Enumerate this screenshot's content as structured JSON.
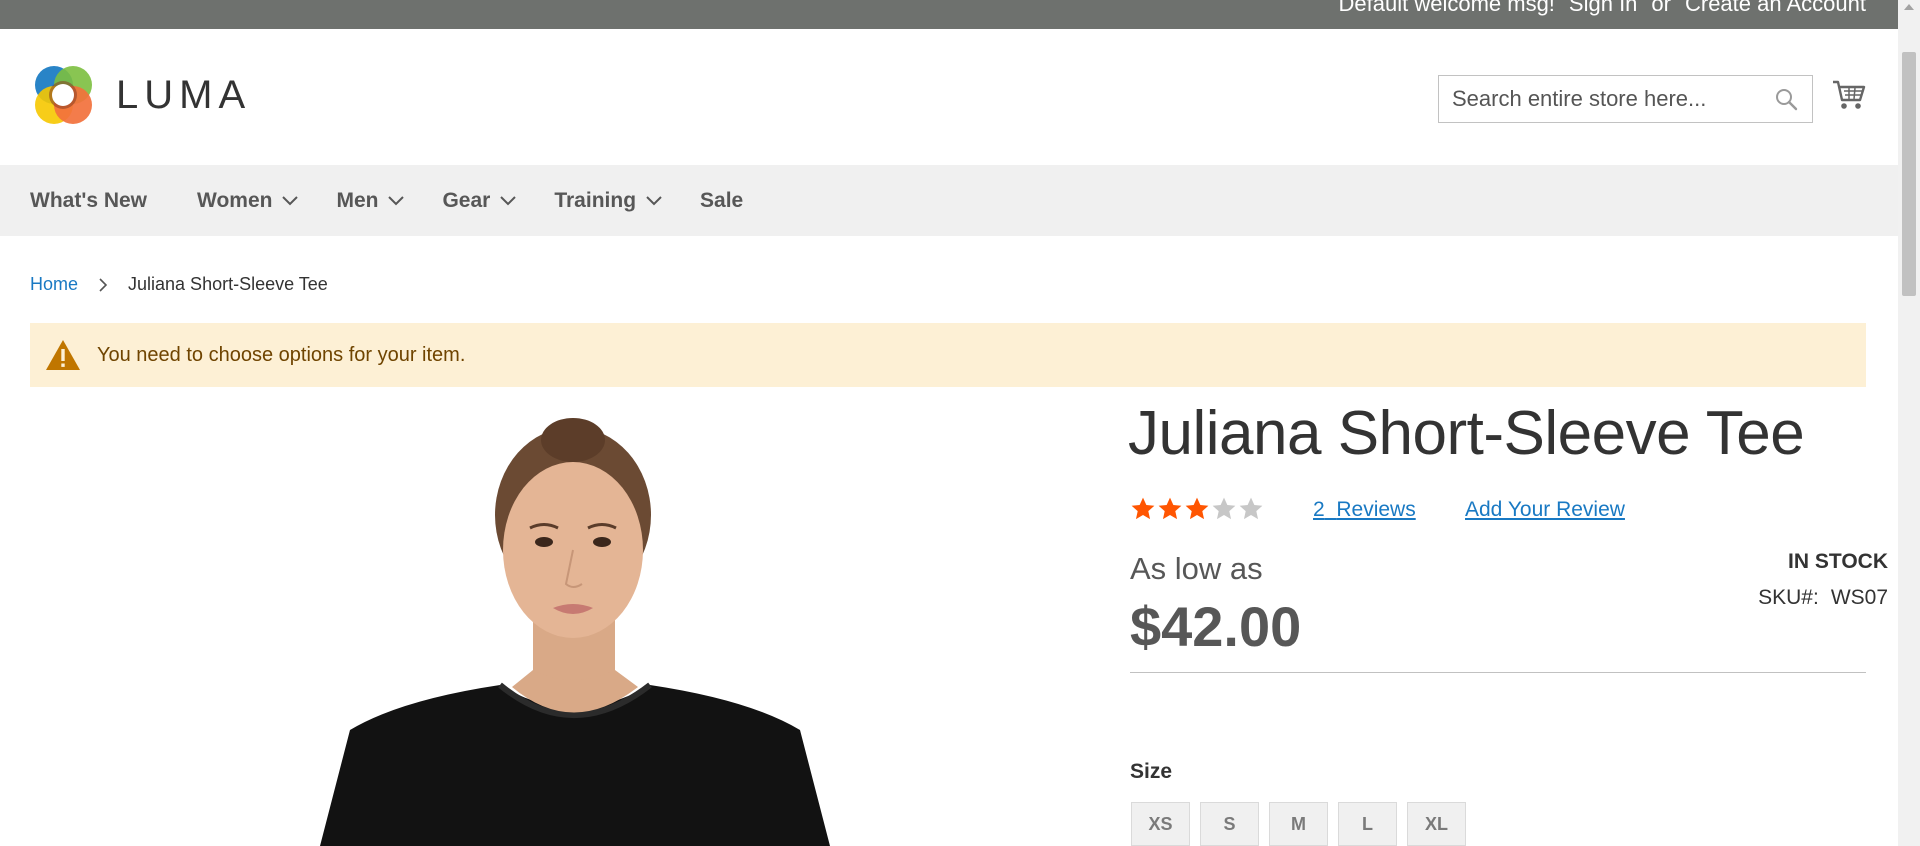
{
  "top_bar": {
    "welcome": "Default welcome msg!",
    "sign_in": "Sign In",
    "or": "or",
    "create_account": "Create an Account"
  },
  "header": {
    "logo_text": "LUMA",
    "search_placeholder": "Search entire store here...",
    "search_icon": "search-icon",
    "cart_icon": "cart-icon"
  },
  "nav": {
    "items": [
      {
        "label": "What's New",
        "has_dropdown": false
      },
      {
        "label": "Women",
        "has_dropdown": true
      },
      {
        "label": "Men",
        "has_dropdown": true
      },
      {
        "label": "Gear",
        "has_dropdown": true
      },
      {
        "label": "Training",
        "has_dropdown": true
      },
      {
        "label": "Sale",
        "has_dropdown": false
      }
    ]
  },
  "breadcrumb": {
    "home": "Home",
    "current": "Juliana Short-Sleeve Tee"
  },
  "message": {
    "text": "You need to choose options for your item.",
    "icon": "warning-icon"
  },
  "product": {
    "title": "Juliana Short-Sleeve Tee",
    "rating_stars": 3,
    "rating_max": 5,
    "reviews_count": "2",
    "reviews_label": "Reviews",
    "add_review": "Add Your Review",
    "price_prefix": "As low as",
    "price": "$42.00",
    "stock": "IN STOCK",
    "sku_label": "SKU#:",
    "sku": "WS07",
    "size_label": "Size",
    "sizes": [
      "XS",
      "S",
      "M",
      "L",
      "XL"
    ]
  },
  "colors": {
    "link": "#1979c3",
    "star_on": "#ff5501",
    "star_off": "#c7c7c7",
    "message_bg": "#fdf0d5",
    "top_bar_bg": "#6e716e",
    "nav_bg": "#f0f0f0"
  }
}
